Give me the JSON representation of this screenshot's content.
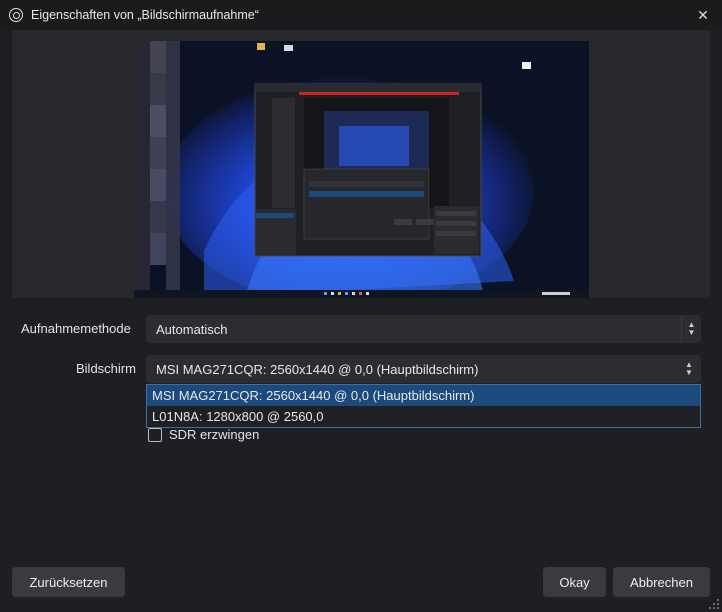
{
  "window": {
    "title": "Eigenschaften von „Bildschirmaufnahme“",
    "close_label": "✕"
  },
  "form": {
    "capture_method_label": "Aufnahmemethode",
    "capture_method_value": "Automatisch",
    "display_label": "Bildschirm",
    "display_value": "MSI MAG271CQR: 2560x1440 @ 0,0 (Hauptbildschirm)",
    "display_options": [
      "MSI MAG271CQR: 2560x1440 @ 0,0 (Hauptbildschirm)",
      "L01N8A: 1280x800 @ 2560,0"
    ],
    "selected_option_index": 0,
    "force_sdr_label": "SDR erzwingen",
    "force_sdr_checked": false
  },
  "buttons": {
    "reset": "Zurücksetzen",
    "ok": "Okay",
    "cancel": "Abbrechen"
  },
  "colors": {
    "accent": "#1c4a7d",
    "dropdown_border": "#3d6ea8"
  }
}
